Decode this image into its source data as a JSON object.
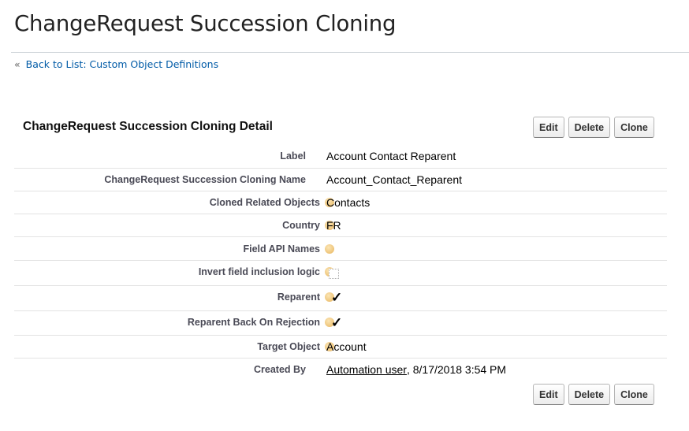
{
  "page": {
    "title": "ChangeRequest Succession Cloning",
    "back_link_prefix": "«",
    "back_link_text": "Back to List: Custom Object Definitions"
  },
  "detail": {
    "title": "ChangeRequest Succession Cloning Detail",
    "buttons": {
      "edit": "Edit",
      "delete": "Delete",
      "clone": "Clone"
    },
    "fields": {
      "label": {
        "label": "Label",
        "value": "Account Contact Reparent"
      },
      "name": {
        "label": "ChangeRequest Succession Cloning Name",
        "value": "Account_Contact_Reparent"
      },
      "cloned_related_objects": {
        "label": "Cloned Related Objects",
        "value": "Contacts"
      },
      "country": {
        "label": "Country",
        "value": "FR"
      },
      "field_api_names": {
        "label": "Field API Names",
        "value": ""
      },
      "invert_field_inclusion_logic": {
        "label": "Invert field inclusion logic",
        "checked": false
      },
      "reparent": {
        "label": "Reparent",
        "checked": true,
        "check_glyph": "✓"
      },
      "reparent_back_on_rejection": {
        "label": "Reparent Back On Rejection",
        "checked": true,
        "check_glyph": "✓"
      },
      "target_object": {
        "label": "Target Object",
        "value": "Account"
      },
      "created_by": {
        "label": "Created By",
        "user": "Automation user",
        "date": ", 8/17/2018 3:54 PM"
      }
    }
  },
  "colors": {
    "link": "#015ba7",
    "help_icon": "#e8b55e",
    "row_border": "#e3e3e3"
  }
}
